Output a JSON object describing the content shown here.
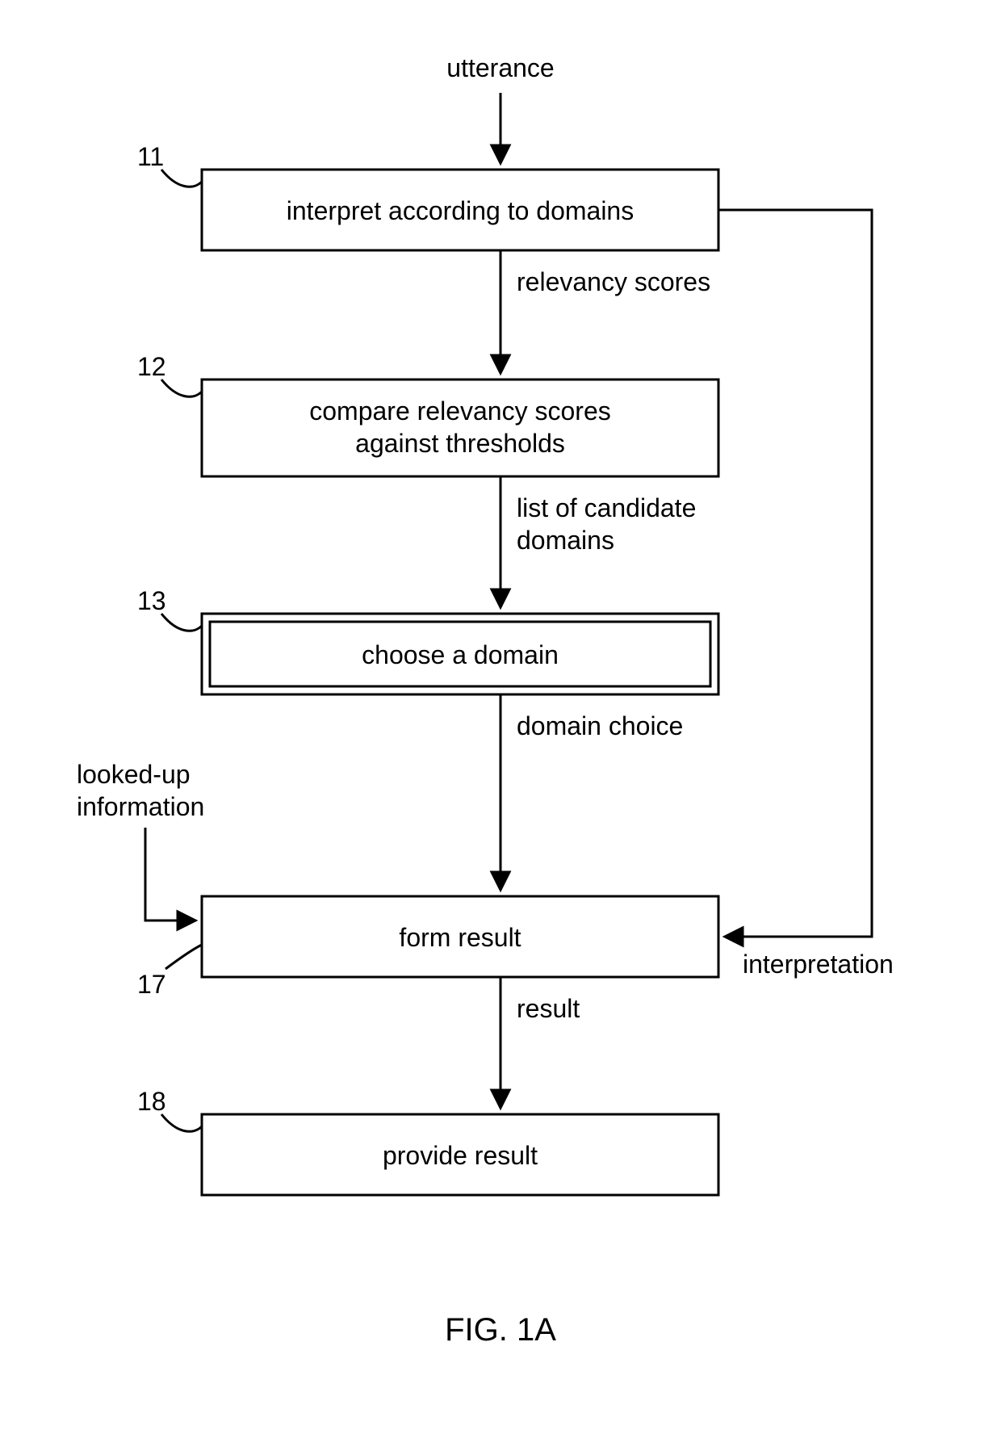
{
  "figure_label": "FIG. 1A",
  "input_label": "utterance",
  "boxes": {
    "b11": {
      "ref": "11",
      "text": "interpret according to domains"
    },
    "b12": {
      "ref": "12",
      "line1": "compare relevancy scores",
      "line2": "against thresholds"
    },
    "b13": {
      "ref": "13",
      "text": "choose a domain"
    },
    "b17": {
      "ref": "17",
      "text": "form result"
    },
    "b18": {
      "ref": "18",
      "text": "provide result"
    }
  },
  "edges": {
    "e1": "relevancy scores",
    "e2_line1": "list of candidate",
    "e2_line2": "domains",
    "e3": "domain choice",
    "e4": "result",
    "side_right": "interpretation",
    "side_left_line1": "looked-up",
    "side_left_line2": "information"
  }
}
